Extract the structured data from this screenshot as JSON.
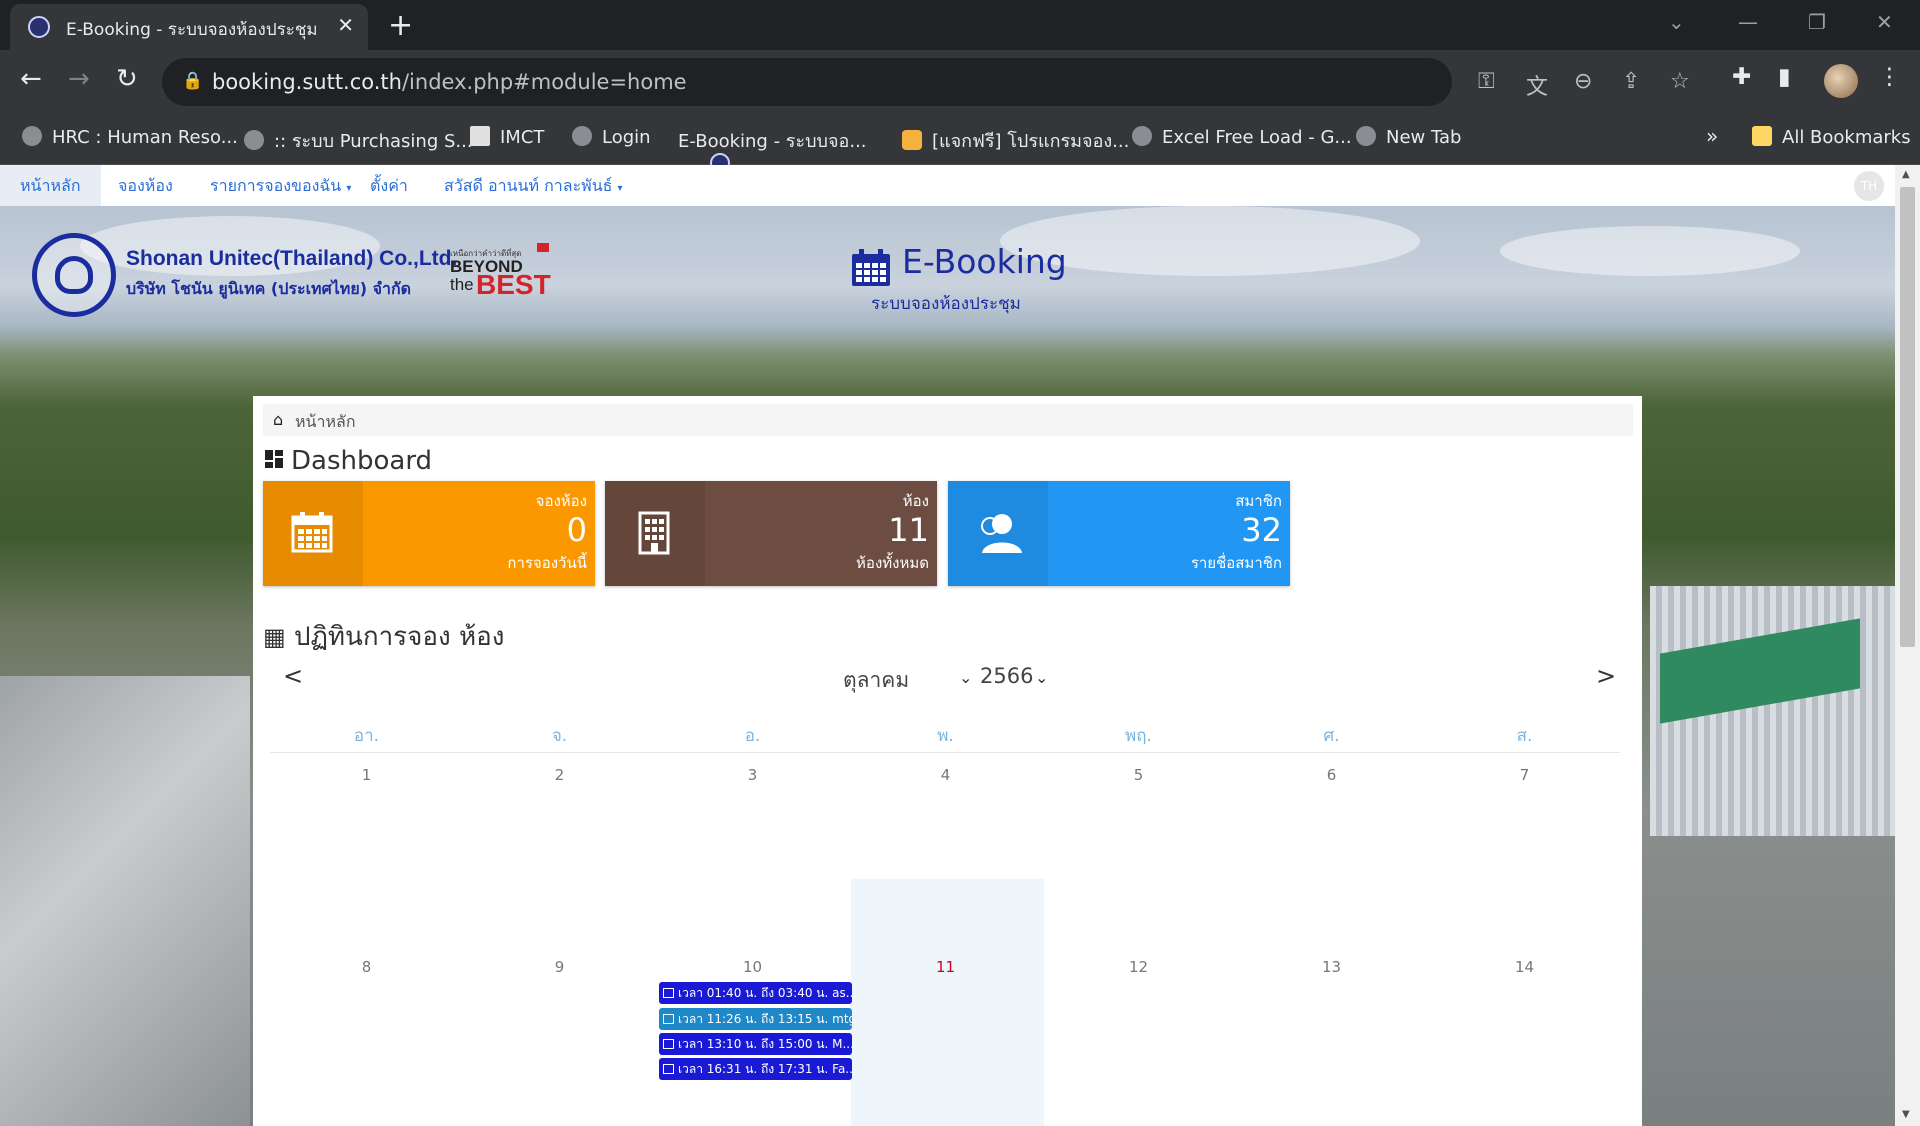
{
  "browser": {
    "tab_title": "E-Booking - ระบบจองห้องประชุม",
    "url_host": "booking.sutt.co.th",
    "url_path": "/index.php#module=home",
    "bookmarks": [
      {
        "label": "HRC : Human Reso...",
        "icon": "globe-icon"
      },
      {
        "label": ":: ระบบ Purchasing S...",
        "icon": "globe-icon"
      },
      {
        "label": "IMCT",
        "icon": "document-icon"
      },
      {
        "label": "Login",
        "icon": "globe-icon"
      },
      {
        "label": "E-Booking - ระบบจอ...",
        "icon": "logo-icon"
      },
      {
        "label": "[แจกฟรี] โปรแกรมจอง...",
        "icon": "app-icon"
      },
      {
        "label": "Excel Free Load - G...",
        "icon": "globe-icon"
      },
      {
        "label": "New Tab",
        "icon": "globe-icon"
      }
    ],
    "more_bookmarks": "»",
    "all_bookmarks": "All Bookmarks"
  },
  "nav": {
    "home": "หน้าหลัก",
    "book_room": "จองห้อง",
    "my_bookings": "รายการจองของฉัน",
    "settings": "ตั้งค่า",
    "user": "สวัสดี อานนท์ กาละพันธ์",
    "avatar_initials": "TH"
  },
  "header": {
    "company_en": "Shonan Unitec(Thailand) Co.,Ltd.",
    "company_th": "บริษัท โชนัน ยูนิเทค (ประเทศไทย) จำกัด",
    "slogan_small": "เหนือกว่าคำว่าดีที่สุด",
    "slogan_beyond": "BEYOND",
    "slogan_the": "the",
    "slogan_best": "BEST",
    "app_title": "E-Booking",
    "app_subtitle": "ระบบจองห้องประชุม"
  },
  "breadcrumb": {
    "home": "หน้าหลัก"
  },
  "dashboard": {
    "title": "Dashboard",
    "cards": [
      {
        "label": "จองห้อง",
        "value": "0",
        "sub": "การจองวันนี้",
        "color": "#fb9800",
        "icon": "calendar-icon"
      },
      {
        "label": "ห้อง",
        "value": "11",
        "sub": "ห้องทั้งหมด",
        "color": "#6d4c41",
        "icon": "building-icon"
      },
      {
        "label": "สมาชิก",
        "value": "32",
        "sub": "รายชื่อสมาชิก",
        "color": "#2196f3",
        "icon": "user-icon"
      }
    ]
  },
  "calendar": {
    "title": "ปฏิทินการจอง ห้อง",
    "prev": "<",
    "next": ">",
    "month": "ตุลาคม",
    "year": "2566",
    "weekdays": [
      "อา.",
      "จ.",
      "อ.",
      "พ.",
      "พฤ.",
      "ศ.",
      "ส."
    ],
    "week1": [
      "1",
      "2",
      "3",
      "4",
      "5",
      "6",
      "7"
    ],
    "week2": [
      "8",
      "9",
      "10",
      "11",
      "12",
      "13",
      "14"
    ],
    "today": "11",
    "events": [
      {
        "text": "เวลา 01:40 น. ถึง 03:40 น. as...",
        "color": "#1a1ad6"
      },
      {
        "text": "เวลา 11:26 น. ถึง 13:15 น. mtg",
        "color": "#1e88c8"
      },
      {
        "text": "เวลา 13:10 น. ถึง 15:00 น. M...",
        "color": "#1a1ad6"
      },
      {
        "text": "เวลา 16:31 น. ถึง 17:31 น. Fa...",
        "color": "#1a1ad6"
      }
    ]
  }
}
